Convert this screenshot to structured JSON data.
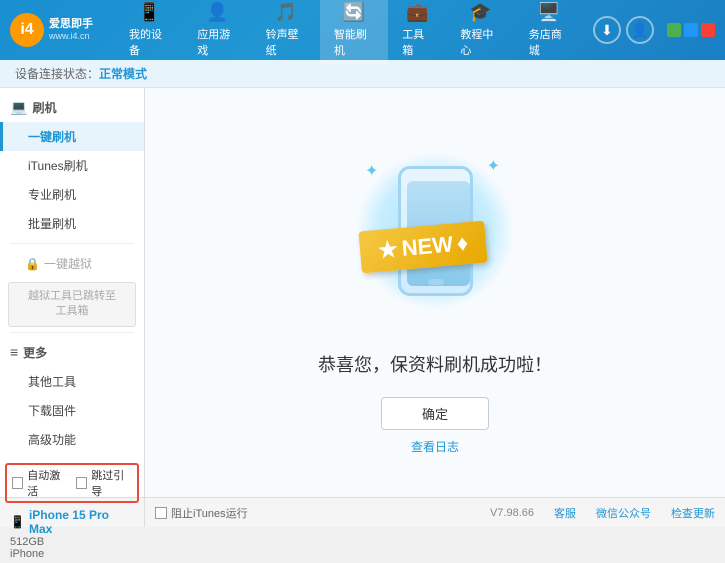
{
  "app": {
    "logo_char": "i4",
    "logo_name": "爱思即手",
    "logo_url": "www.i4.cn"
  },
  "nav": {
    "items": [
      {
        "id": "my-device",
        "label": "我的设备",
        "icon": "📱"
      },
      {
        "id": "apps-games",
        "label": "应用游戏",
        "icon": "👤"
      },
      {
        "id": "ringtones",
        "label": "铃声壁纸",
        "icon": "📋"
      },
      {
        "id": "smart-flash",
        "label": "智能刷机",
        "icon": "🔄",
        "active": true
      },
      {
        "id": "toolbox",
        "label": "工具箱",
        "icon": "💼"
      },
      {
        "id": "tutorial",
        "label": "教程中心",
        "icon": "🎓"
      },
      {
        "id": "service",
        "label": "务店商城",
        "icon": "🖥️"
      }
    ]
  },
  "status_bar": {
    "label": "设备连接状态：",
    "mode": "正常模式"
  },
  "sidebar": {
    "sections": [
      {
        "id": "flash",
        "title": "刷机",
        "icon": "💻",
        "items": [
          {
            "id": "one-click-flash",
            "label": "一键刷机",
            "active": true
          },
          {
            "id": "itunes-flash",
            "label": "iTunes刷机"
          },
          {
            "id": "pro-flash",
            "label": "专业刷机"
          },
          {
            "id": "batch-flash",
            "label": "批量刷机"
          }
        ]
      },
      {
        "id": "jailbreak",
        "title": "一键越狱",
        "disabled": true,
        "disabled_msg": "越狱工具已跳转至\n工具箱"
      },
      {
        "id": "more",
        "title": "更多",
        "icon": "≡",
        "items": [
          {
            "id": "other-tools",
            "label": "其他工具"
          },
          {
            "id": "download-firmware",
            "label": "下载固件"
          },
          {
            "id": "advanced",
            "label": "高级功能"
          }
        ]
      }
    ]
  },
  "content": {
    "new_badge": "NEW",
    "success_message": "恭喜您，保资料刷机成功啦！",
    "confirm_button": "确定",
    "log_link": "查看日志"
  },
  "bottom": {
    "auto_activate_label": "自动激活",
    "guide_label": "跳过引导",
    "device_icon": "📱",
    "device_name": "iPhone 15 Pro Max",
    "device_storage": "512GB",
    "device_type": "iPhone",
    "itunes_label": "阻止iTunes运行",
    "version": "V7.98.66",
    "links": [
      "客服",
      "微信公众号",
      "检查更新"
    ]
  },
  "win_controls": {
    "min": "_",
    "max": "□",
    "close": "✕"
  }
}
